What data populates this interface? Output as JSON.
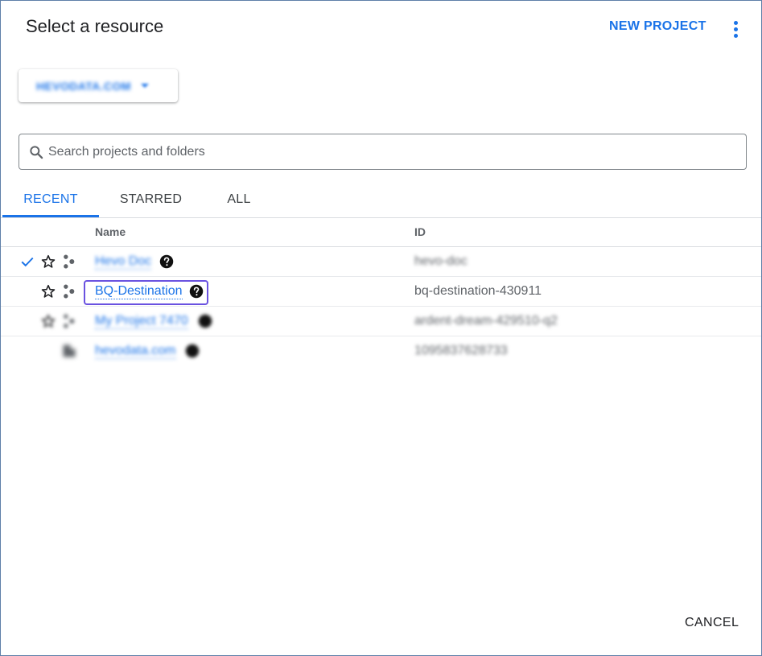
{
  "dialog": {
    "title": "Select a resource",
    "new_project_label": "NEW PROJECT",
    "more_menu_label": "More options",
    "cancel_label": "CANCEL"
  },
  "org_selector": {
    "label": "HEVODATA.COM"
  },
  "search": {
    "placeholder": "Search projects and folders",
    "value": ""
  },
  "tabs": [
    {
      "label": "RECENT",
      "active": true
    },
    {
      "label": "STARRED",
      "active": false
    },
    {
      "label": "ALL",
      "active": false
    }
  ],
  "table": {
    "columns": {
      "name": "Name",
      "id": "ID"
    },
    "rows": [
      {
        "name": "Hevo Doc",
        "id": "hevo-doc",
        "selected": true,
        "type": "project",
        "blurred": true
      },
      {
        "name": "BQ-Destination",
        "id": "bq-destination-430911",
        "selected": false,
        "type": "project",
        "blurred": false
      },
      {
        "name": "My Project 7470",
        "id": "ardent-dream-429510-q2",
        "selected": false,
        "type": "project",
        "blurred": true
      },
      {
        "name": "hevodata.com",
        "id": "1095837628733",
        "selected": false,
        "type": "organization",
        "blurred": true
      }
    ]
  },
  "icons": {
    "search": "search-icon",
    "check": "check-icon",
    "star": "star-outline-icon",
    "project": "project-icon",
    "organization": "organization-icon",
    "help": "help-circle-icon",
    "more": "more-vert-icon",
    "caret": "caret-down-icon"
  },
  "colors": {
    "accent": "#1a73e8",
    "focus": "#6a52e0",
    "text": "#202124",
    "muted": "#5f6368"
  }
}
